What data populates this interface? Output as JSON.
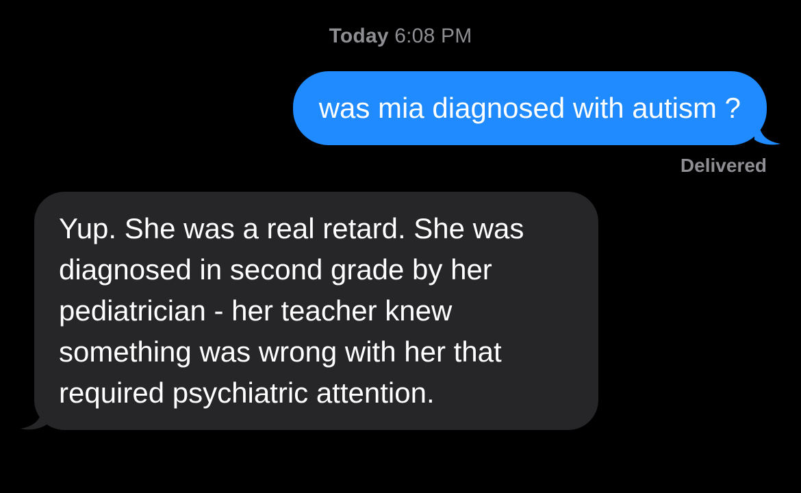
{
  "conversation": {
    "timestamp": {
      "day": "Today",
      "time": "6:08 PM"
    },
    "messages": [
      {
        "direction": "sent",
        "text": "was mia diagnosed with autism ?"
      },
      {
        "direction": "received",
        "text": "Yup. She was a real retard. She was diagnosed in second grade by her pediatrician - her teacher knew something was wrong with her that required psychiatric attention."
      }
    ],
    "delivery_status": "Delivered"
  },
  "colors": {
    "background": "#000000",
    "sent_bubble": "#1f8bff",
    "received_bubble": "#262629",
    "meta_text": "#8e8e93"
  }
}
